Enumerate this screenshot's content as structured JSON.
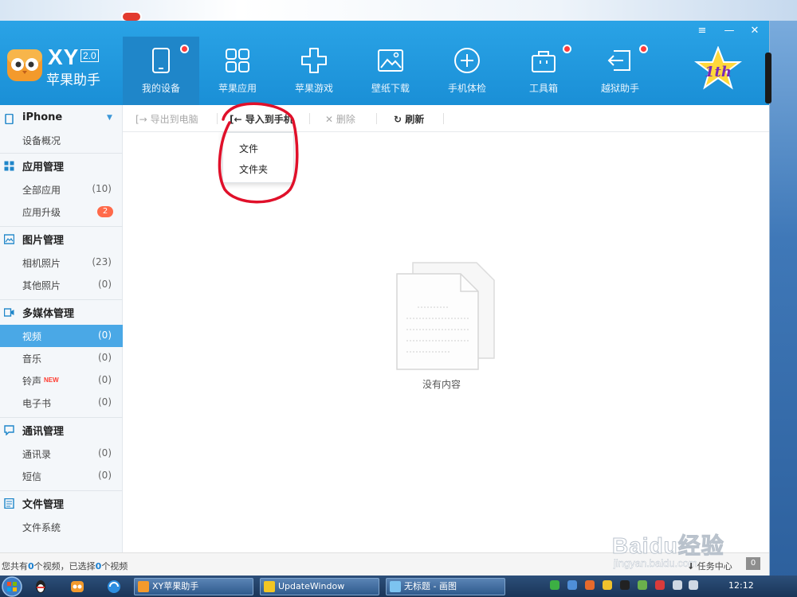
{
  "app": {
    "brand_xy": "XY",
    "brand_version": "2.0",
    "brand_name": "苹果助手"
  },
  "nav": [
    {
      "label": "我的设备",
      "icon": "tablet-icon",
      "active": true,
      "dot": true
    },
    {
      "label": "苹果应用",
      "icon": "apps-grid-icon",
      "active": false,
      "dot": false
    },
    {
      "label": "苹果游戏",
      "icon": "gamepad-icon",
      "active": false,
      "dot": false
    },
    {
      "label": "壁纸下载",
      "icon": "picture-icon",
      "active": false,
      "dot": false
    },
    {
      "label": "手机体检",
      "icon": "plus-circle-icon",
      "active": false,
      "dot": false
    },
    {
      "label": "工具箱",
      "icon": "toolbox-icon",
      "active": false,
      "dot": true
    },
    {
      "label": "越狱助手",
      "icon": "jailbreak-icon",
      "active": false,
      "dot": true
    }
  ],
  "window_controls": {
    "menu": "≡",
    "minimize": "—",
    "close": "✕"
  },
  "sidebar": {
    "device": "iPhone",
    "device_overview": "设备概况",
    "app_mgmt": "应用管理",
    "all_apps": "全部应用",
    "all_apps_count": "(10)",
    "app_update": "应用升级",
    "app_update_count": "2",
    "photo_mgmt": "图片管理",
    "camera_photos": "相机照片",
    "camera_photos_count": "(23)",
    "other_photos": "其他照片",
    "other_photos_count": "(0)",
    "media_mgmt": "多媒体管理",
    "video": "视频",
    "video_count": "(0)",
    "music": "音乐",
    "music_count": "(0)",
    "ringtone": "铃声",
    "ringtone_new": "NEW",
    "ringtone_count": "(0)",
    "ebook": "电子书",
    "ebook_count": "(0)",
    "comm_mgmt": "通讯管理",
    "contacts": "通讯录",
    "contacts_count": "(0)",
    "sms": "短信",
    "sms_count": "(0)",
    "file_mgmt": "文件管理",
    "file_system": "文件系统"
  },
  "toolbar": {
    "export": "导出到电脑",
    "import": "导入到手机",
    "delete": "删除",
    "refresh": "刷新"
  },
  "dropdown": {
    "file": "文件",
    "folder": "文件夹"
  },
  "content": {
    "empty": "没有内容"
  },
  "status": {
    "prefix": "您共有",
    "total": "0",
    "mid": "个视频，已选择",
    "selected": "0",
    "suffix": "个视频",
    "task_center": "任务中心",
    "task_count": "0"
  },
  "taskbar": {
    "items": [
      "XY苹果助手",
      "UpdateWindow",
      "无标题 - 画图"
    ],
    "clock": "12:12"
  },
  "watermark": {
    "brand": "Baidu经验",
    "url": "jingyan.baidu.com"
  },
  "colors": {
    "header": "#1a8fd6",
    "accent": "#4aa8e6",
    "annotation": "#e0102a"
  }
}
